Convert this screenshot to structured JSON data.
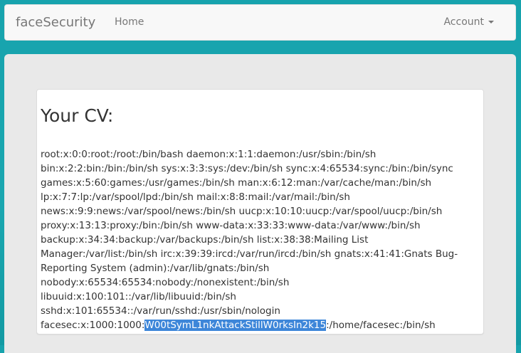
{
  "navbar": {
    "brand": "faceSecurity",
    "home_label": "Home",
    "account_label": "Account"
  },
  "cv": {
    "title": "Your CV:",
    "lines": [
      "root:x:0:0:root:/root:/bin/bash daemon:x:1:1:daemon:/usr/sbin:/bin/sh",
      "bin:x:2:2:bin:/bin:/bin/sh sys:x:3:3:sys:/dev:/bin/sh sync:x:4:65534:sync:/bin:/bin/sync",
      "games:x:5:60:games:/usr/games:/bin/sh man:x:6:12:man:/var/cache/man:/bin/sh",
      "lp:x:7:7:lp:/var/spool/lpd:/bin/sh mail:x:8:8:mail:/var/mail:/bin/sh",
      "news:x:9:9:news:/var/spool/news:/bin/sh uucp:x:10:10:uucp:/var/spool/uucp:/bin/sh",
      "proxy:x:13:13:proxy:/bin:/bin/sh www-data:x:33:33:www-data:/var/www:/bin/sh",
      "backup:x:34:34:backup:/var/backups:/bin/sh list:x:38:38:Mailing List",
      "Manager:/var/list:/bin/sh irc:x:39:39:ircd:/var/run/ircd:/bin/sh gnats:x:41:41:Gnats Bug-",
      "Reporting System (admin):/var/lib/gnats:/bin/sh",
      "nobody:x:65534:65534:nobody:/nonexistent:/bin/sh",
      "libuuid:x:100:101::/var/lib/libuuid:/bin/sh",
      "sshd:x:101:65534::/var/run/sshd:/usr/sbin/nologin"
    ],
    "last_line_prefix": "facesec:x:1000:1000:",
    "last_line_selected": "W00tSymL1nkAttackStillW0rksIn2k15",
    "last_line_suffix": ":/home/facesec:/bin/sh"
  },
  "colors": {
    "background": "#17a3ad",
    "selection": "#3d86d9"
  }
}
